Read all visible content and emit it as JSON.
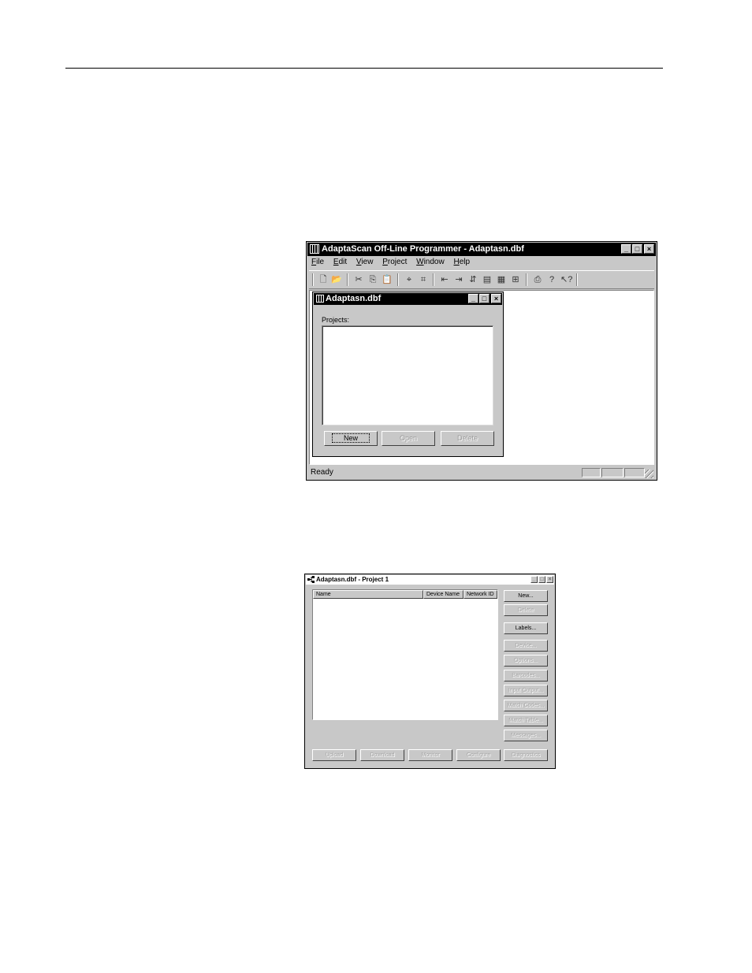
{
  "main_window": {
    "title": "AdaptaScan Off-Line Programmer - Adaptasn.dbf",
    "menu": [
      {
        "prefix": "",
        "accel": "F",
        "rest": "ile"
      },
      {
        "prefix": "",
        "accel": "E",
        "rest": "dit"
      },
      {
        "prefix": "",
        "accel": "V",
        "rest": "iew"
      },
      {
        "prefix": "",
        "accel": "P",
        "rest": "roject"
      },
      {
        "prefix": "",
        "accel": "W",
        "rest": "indow"
      },
      {
        "prefix": "",
        "accel": "H",
        "rest": "elp"
      }
    ],
    "toolbar_icons": [
      "new-document-icon",
      "open-folder-icon",
      "cut-icon",
      "copy-icon",
      "paste-icon",
      "network-icon",
      "network-config-icon",
      "upload-icon",
      "download-icon",
      "transfer-icon",
      "monitor-icon",
      "display-icon",
      "compare-icon",
      "print-icon",
      "help-icon",
      "context-help-icon"
    ],
    "status": "Ready"
  },
  "project_window": {
    "title": "Adaptasn.dbf",
    "projects_label": "Projects:",
    "buttons": {
      "new": "New",
      "open": "Open",
      "delete": "Delete"
    }
  },
  "device_window": {
    "title": "Adaptasn.dbf - Project 1",
    "columns": [
      "Name",
      "Device Name",
      "Network ID"
    ],
    "side_buttons": [
      {
        "label": "New...",
        "enabled": true
      },
      {
        "label": "Delete",
        "enabled": false
      },
      {
        "label": "Labels...",
        "enabled": true
      },
      {
        "label": "Device...",
        "enabled": false
      },
      {
        "label": "Options...",
        "enabled": false
      },
      {
        "label": "Barcodes...",
        "enabled": false
      },
      {
        "label": "Input Output...",
        "enabled": false
      },
      {
        "label": "Match Codes...",
        "enabled": false
      },
      {
        "label": "Match Table...",
        "enabled": false
      },
      {
        "label": "Messages...",
        "enabled": false
      }
    ],
    "bottom_buttons": [
      "Upload",
      "Download",
      "Monitor",
      "Configure",
      "Diagnostics"
    ]
  }
}
